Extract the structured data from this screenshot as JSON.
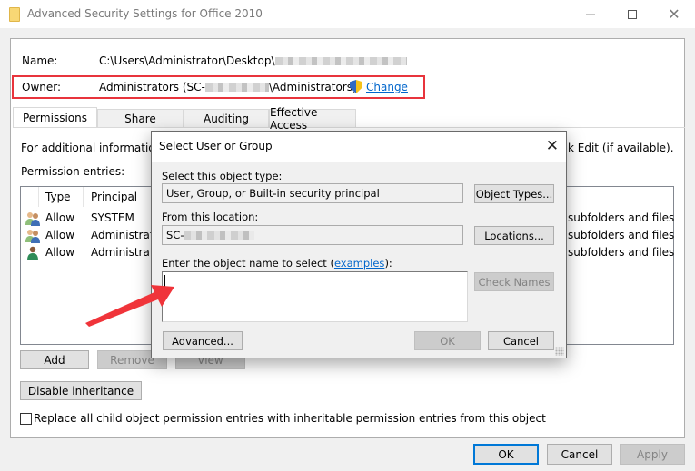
{
  "window": {
    "title": "Advanced Security Settings for Office 2010",
    "controls": {
      "minimize": "—",
      "maximize": "□",
      "close": "✕"
    }
  },
  "info": {
    "name_label": "Name:",
    "name_value": "C:\\Users\\Administrator\\Desktop\\",
    "owner_label": "Owner:",
    "owner_value_prefix": "Administrators (SC-",
    "owner_value_suffix": "\\Administrators)",
    "change_link": "Change"
  },
  "tabs": [
    {
      "label": "Permissions",
      "active": true
    },
    {
      "label": "Share",
      "active": false
    },
    {
      "label": "Auditing",
      "active": false
    },
    {
      "label": "Effective Access",
      "active": false
    }
  ],
  "permissions": {
    "info_text_start": "For additional information,",
    "info_text_end": "k Edit (if available).",
    "entries_label": "Permission entries:",
    "columns": [
      "Type",
      "Principal"
    ],
    "rows": [
      {
        "icon": "users-group-icon",
        "type": "Allow",
        "principal": "SYSTEM",
        "applies_to_tail": "subfolders and files"
      },
      {
        "icon": "users-group-icon",
        "type": "Allow",
        "principal": "Administrato",
        "applies_to_tail": "subfolders and files"
      },
      {
        "icon": "user-icon",
        "type": "Allow",
        "principal": "Administrato",
        "applies_to_tail": "subfolders and files"
      }
    ],
    "buttons": {
      "add": "Add",
      "remove": "Remove",
      "view": "View"
    },
    "disable_inheritance": "Disable inheritance",
    "replace_checkbox_label": "Replace all child object permission entries with inheritable permission entries from this object",
    "replace_checked": false
  },
  "footer": {
    "ok": "OK",
    "cancel": "Cancel",
    "apply": "Apply"
  },
  "dialog": {
    "title": "Select User or Group",
    "close": "✕",
    "object_type_label": "Select this object type:",
    "object_type_value": "User, Group, or Built-in security principal",
    "object_types_button": "Object Types...",
    "location_label": "From this location:",
    "location_value": "SC-",
    "locations_button": "Locations...",
    "enter_label_prefix": "Enter the object name to select (",
    "examples_link": "examples",
    "enter_label_suffix": "):",
    "object_name_value": "",
    "check_names_button": "Check Names",
    "advanced_button": "Advanced...",
    "ok_button": "OK",
    "cancel_button": "Cancel"
  },
  "annotations": {
    "highlight_color": "#e8343c",
    "arrow_color": "#f0343a"
  }
}
